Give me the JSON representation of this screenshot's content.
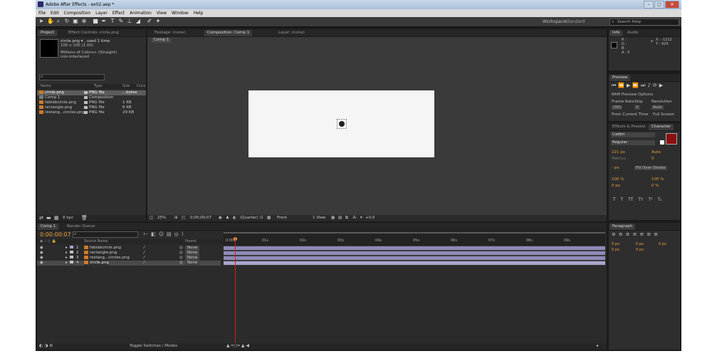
{
  "window": {
    "title": "Adobe After Effects - ex02.aep *",
    "controls": [
      "–",
      "□",
      "✕"
    ]
  },
  "menu": [
    "File",
    "Edit",
    "Composition",
    "Layer",
    "Effect",
    "Animation",
    "View",
    "Window",
    "Help"
  ],
  "toolbar": {
    "workspace_label": "Workspace:",
    "workspace_value": "Standard",
    "search_placeholder": "Search Help"
  },
  "project_panel": {
    "tab_project": "Project",
    "tab_effect_controls": "Effect Controls: circle.png",
    "item_name": "circle.png ▾ , used 1 time",
    "item_size": "100 x 100 (1.00)",
    "item_colors": "Millions of Colors+ (Straight)",
    "item_interlace": "non-interlaced",
    "columns": [
      "Name",
      "Type",
      "Size",
      "Dura"
    ],
    "items": [
      {
        "name": "circle.png",
        "type": "PNG file",
        "size": "...bytes",
        "kind": "png",
        "selected": true
      },
      {
        "name": "Comp 1",
        "type": "Composition",
        "size": "",
        "kind": "comp",
        "selected": false
      },
      {
        "name": "fablabcircle.png",
        "type": "PNG file",
        "size": "1 KB",
        "kind": "png",
        "selected": false
      },
      {
        "name": "rectangle.png",
        "type": "PNG file",
        "size": "6 KB",
        "kind": "png",
        "selected": false
      },
      {
        "name": "restang...circles.png",
        "type": "PNG file",
        "size": "29 KB",
        "kind": "png",
        "selected": false
      }
    ],
    "bpc": "8 bpc"
  },
  "viewer": {
    "tab_footage": "Footage: (none)",
    "tab_composition": "Composition: Comp 1",
    "tab_layer": "Layer: (none)",
    "breadcrumb": "Comp 1",
    "zoom": "25%",
    "timecode": "0;00;00;07",
    "resolution": "(Quarter)",
    "view": "Front",
    "views_count": "1 View",
    "exposure": "+0.0"
  },
  "info_panel": {
    "tab_info": "Info",
    "tab_audio": "Audio",
    "r": "R :",
    "g": "G :",
    "b": "B :",
    "a": "A : 0",
    "x": "X : -1212",
    "y": "Y : 424"
  },
  "preview_panel": {
    "tab": "Preview",
    "ram_options": "RAM Preview Options",
    "frame_rate_label": "Frame Rate",
    "skip_label": "Skip",
    "resolution_label": "Resolution",
    "frame_rate_value": "(30)",
    "skip_value": "0",
    "resolution_value": "Auto",
    "from_current": "From Current Time",
    "full_screen": "Full Screen"
  },
  "character_panel": {
    "tab_effects": "Effects & Presets",
    "tab_character": "Character",
    "font": "Calibri",
    "style": "Regular",
    "size": "221 px",
    "leading": "Auto",
    "kerning": "Metrics",
    "tracking": "0",
    "stroke": "- px",
    "stroke_mode": "Fill Over Stroke",
    "v_scale": "100 %",
    "h_scale": "100 %",
    "baseline": "0 px",
    "tsume": "0 %",
    "styles": [
      "T",
      "T",
      "TT",
      "Tт",
      "T¹",
      "T₁"
    ]
  },
  "paragraph_panel": {
    "tab": "Paragraph",
    "indent_left": "0 px",
    "indent_right": "0 px",
    "space_before": "0 px",
    "first_line": "0 px",
    "space_after": "0 px"
  },
  "timeline": {
    "tab_comp": "Comp 1",
    "tab_render": "Render Queue",
    "timecode": "0:00:00:07",
    "header_source": "Source Name",
    "header_parent": "Parent",
    "ticks": [
      "0:00s",
      "01s",
      "02s",
      "03s",
      "04s",
      "05s",
      "06s",
      "07s",
      "08s",
      "09s"
    ],
    "layers": [
      {
        "num": "1",
        "name": "fablabcircle.png",
        "parent": "None"
      },
      {
        "num": "2",
        "name": "rectangle.png",
        "parent": "None"
      },
      {
        "num": "3",
        "name": "restang...circles.png",
        "parent": "None"
      },
      {
        "num": "4",
        "name": "circle.png",
        "parent": "None"
      }
    ],
    "toggle_label": "Toggle Switches / Modes"
  },
  "colors": {
    "layer_bar": "#8e8ab8",
    "playhead": "#d02020",
    "timecode": "#e8a23a"
  }
}
